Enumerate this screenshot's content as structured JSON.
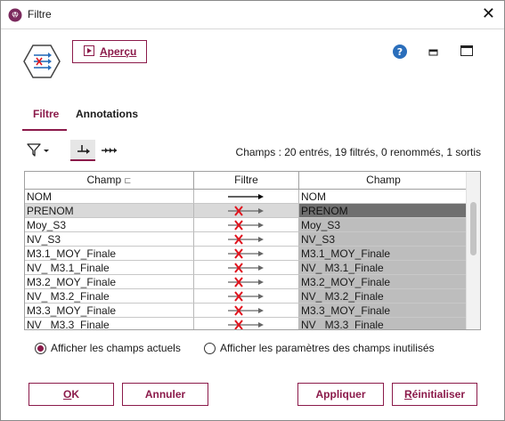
{
  "window": {
    "title": "Filtre",
    "close_glyph": "✕"
  },
  "toolbar": {
    "preview_label": "Aperçu",
    "icons": [
      "filter-node-icon",
      "preview-icon",
      "help-icon",
      "minimize-icon",
      "maximize-icon"
    ]
  },
  "tabs": [
    {
      "label": "Filtre",
      "active": true
    },
    {
      "label": "Annotations",
      "active": false
    }
  ],
  "filter_toolbar": {
    "funnel_icon": "funnel-dropdown-icon",
    "mode_icons": [
      "flow-mode-icon",
      "multi-arrow-icon"
    ],
    "summary": "Champs : 20 entrés, 19 filtrés, 0 renommés, 1 sortis"
  },
  "table": {
    "headers": {
      "champ_in": "Champ",
      "filtre": "Filtre",
      "champ_out": "Champ",
      "sort_glyph": "⊏"
    },
    "rows": [
      {
        "in": "NOM",
        "out": "NOM",
        "filtered": false
      },
      {
        "in": "PRENOM",
        "out": "PRENOM",
        "filtered": true
      },
      {
        "in": "Moy_S3",
        "out": "Moy_S3",
        "filtered": true
      },
      {
        "in": "NV_S3",
        "out": "NV_S3",
        "filtered": true
      },
      {
        "in": "M3.1_MOY_Finale",
        "out": "M3.1_MOY_Finale",
        "filtered": true
      },
      {
        "in": "NV_ M3.1_Finale",
        "out": "NV_ M3.1_Finale",
        "filtered": true
      },
      {
        "in": "M3.2_MOY_Finale",
        "out": "M3.2_MOY_Finale",
        "filtered": true
      },
      {
        "in": "NV_ M3.2_Finale",
        "out": "NV_ M3.2_Finale",
        "filtered": true
      },
      {
        "in": "M3.3_MOY_Finale",
        "out": "M3.3_MOY_Finale",
        "filtered": true
      },
      {
        "in": "NV_ M3.3_Finale",
        "out": "NV_ M3.3_Finale",
        "filtered": true
      }
    ],
    "selected_index": 1
  },
  "options": {
    "radio_current": "Afficher les champs actuels",
    "radio_unused": "Afficher les paramètres des champs inutilisés",
    "selected": "current"
  },
  "buttons": {
    "ok": "OK",
    "cancel": "Annuler",
    "apply": "Appliquer",
    "reset": "Réinitialiser"
  },
  "colors": {
    "accent": "#8b1a4a",
    "help_blue": "#2a6ebb",
    "cross_red": "#e0141e"
  }
}
